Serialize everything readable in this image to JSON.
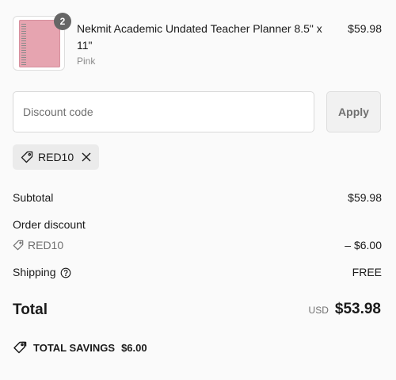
{
  "product": {
    "name": "Nekmit Academic Undated Teacher Planner 8.5\" x 11\"",
    "variant": "Pink",
    "price": "$59.98",
    "quantity": "2"
  },
  "discount": {
    "placeholder": "Discount code",
    "apply_label": "Apply",
    "applied_code": "RED10"
  },
  "summary": {
    "subtotal_label": "Subtotal",
    "subtotal_value": "$59.98",
    "order_discount_label": "Order discount",
    "discount_code": "RED10",
    "discount_value": "– $6.00",
    "shipping_label": "Shipping",
    "shipping_value": "FREE",
    "total_label": "Total",
    "total_currency": "USD",
    "total_value": "$53.98",
    "savings_label": "TOTAL SAVINGS",
    "savings_value": "$6.00"
  },
  "colors": {
    "background": "#fafafa",
    "product_pink": "#e6a4b0",
    "muted_text": "#707070",
    "badge": "#666666"
  },
  "icons": {
    "tag": "tag-icon",
    "remove": "close-icon",
    "help": "question-circle-icon",
    "savings": "double-tag-icon"
  }
}
